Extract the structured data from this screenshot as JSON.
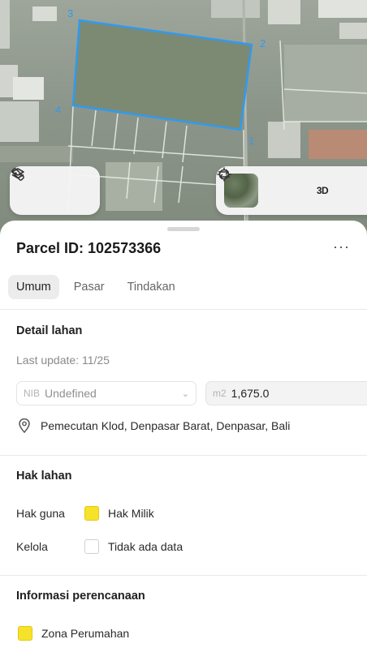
{
  "map": {
    "vertex_labels": [
      "3",
      "2",
      "1",
      "4"
    ],
    "layers_icon": "layers-icon",
    "measure_icon": "ruler-icon",
    "locate_icon": "crosshair-icon",
    "three_d_label": "3D",
    "swap_icon": "swap-icon",
    "parcel_outline_color": "#2f9bf0"
  },
  "sheet": {
    "title": "Parcel ID: 102573366",
    "more_label": "···",
    "tabs": [
      {
        "label": "Umum",
        "active": true
      },
      {
        "label": "Pasar",
        "active": false
      },
      {
        "label": "Tindakan",
        "active": false
      }
    ]
  },
  "detail": {
    "heading": "Detail lahan",
    "last_update": "Last update: 11/25",
    "nib_prefix": "NIB",
    "nib_value": "Undefined",
    "area_unit": "m2",
    "area_value": "1,675.0",
    "location": "Pemecutan Klod, Denpasar Barat, Denpasar, Bali"
  },
  "rights": {
    "heading": "Hak lahan",
    "rows": [
      {
        "label": "Hak guna",
        "value": "Hak Milik",
        "swatch": "#f7e22b"
      },
      {
        "label": "Kelola",
        "value": "Tidak ada data",
        "swatch": "none"
      }
    ]
  },
  "planning": {
    "heading": "Informasi perencanaan",
    "zone": "Zona Perumahan",
    "zone_color": "#f7e22b"
  }
}
